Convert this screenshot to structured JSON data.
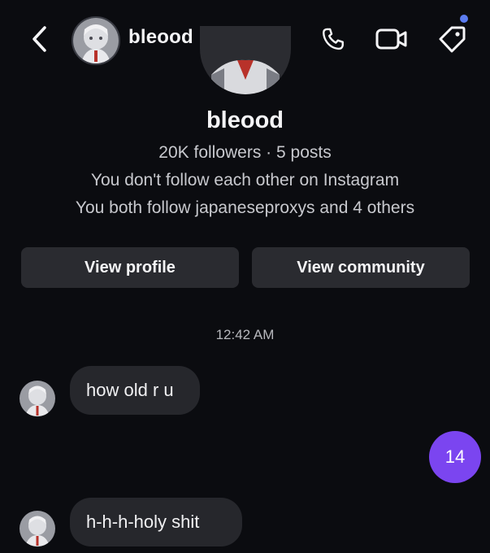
{
  "header": {
    "username": "bleood",
    "icons": [
      "back-chevron-icon",
      "phone-icon",
      "video-icon",
      "tag-icon"
    ]
  },
  "profile": {
    "name": "bleood",
    "stats": "20K followers · 5 posts",
    "follow_status": "You don't follow each other on Instagram",
    "mutuals": "You both follow japaneseproxys and 4 others",
    "view_profile_label": "View profile",
    "view_community_label": "View community"
  },
  "thread": {
    "timestamp": "12:42 AM",
    "messages": [
      {
        "from": "other",
        "text": "how old r u"
      },
      {
        "from": "self",
        "text": "14"
      },
      {
        "from": "other",
        "text": "h-h-h-holy shit"
      }
    ]
  },
  "colors": {
    "background": "#0b0c10",
    "bubble_other": "#26272c",
    "bubble_self": "#7b45f0",
    "notification_dot": "#5b7cf0"
  }
}
